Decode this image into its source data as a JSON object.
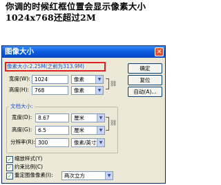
{
  "caption": {
    "line1": "你调的时候红框位置会显示像素大小",
    "line2": "1024x768还超过2M"
  },
  "dialog": {
    "title": "图像大小",
    "pixel_size_label": "像素大小:2.25M(之前为313.9M)",
    "width_label": "宽度(W):",
    "width_value": "1024",
    "width_unit": "像素",
    "height_label": "高度(H):",
    "height_value": "768",
    "height_unit": "像素",
    "doc_size_label": "文档大小:",
    "doc_width_label": "宽度(D):",
    "doc_width_value": "8.67",
    "doc_width_unit": "厘米",
    "doc_height_label": "高度(G):",
    "doc_height_value": "6.5",
    "doc_height_unit": "厘米",
    "resolution_label": "分辨率(R):",
    "resolution_value": "300",
    "resolution_unit": "像素/英寸",
    "scale_styles_label": "缩放样式(Y)",
    "constrain_label": "约束比例(C)",
    "resample_label": "重定图像像素(I):",
    "resample_value": "两次立方",
    "ok_label": "确定",
    "reset_label": "复位",
    "auto_label": "自动(A)..."
  }
}
